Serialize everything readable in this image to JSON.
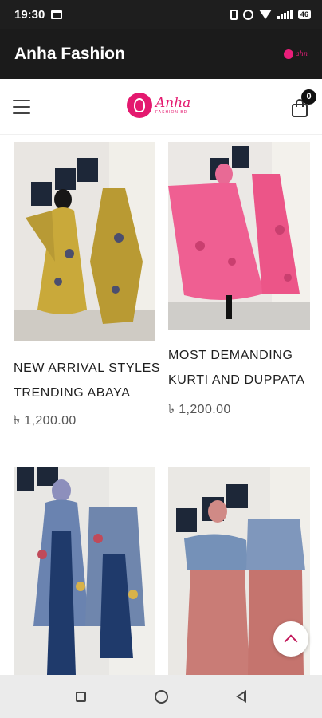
{
  "status_bar": {
    "time": "19:30",
    "battery": "46"
  },
  "header": {
    "title": "Anha Fashion",
    "logo_text": "ahn"
  },
  "nav": {
    "brand_name": "Anha",
    "brand_sub": "FASHION BD",
    "cart_count": "0"
  },
  "products": [
    {
      "name_line1": "NEW ARRIVAL STYLES",
      "name_line2": "TRENDING ABAYA",
      "price": "৳ 1,200.00",
      "image_colors": [
        "#c9a93a",
        "#8b7a2e"
      ]
    },
    {
      "name_line1": "MOST DEMANDING",
      "name_line2": "KURTI AND DUPPATA",
      "price": "৳ 1,200.00",
      "image_colors": [
        "#ef5f92",
        "#c93f6f"
      ]
    },
    {
      "name_line1": "",
      "name_line2": "",
      "price": "",
      "image_colors": [
        "#3d5d8c",
        "#1f3a6b"
      ]
    },
    {
      "name_line1": "",
      "name_line2": "",
      "price": "",
      "image_colors": [
        "#c97c76",
        "#7591b8"
      ]
    }
  ],
  "colors": {
    "brand": "#e4196f",
    "header_bg": "#1b1b1b",
    "status_bar_bg": "#1e1e1e"
  }
}
